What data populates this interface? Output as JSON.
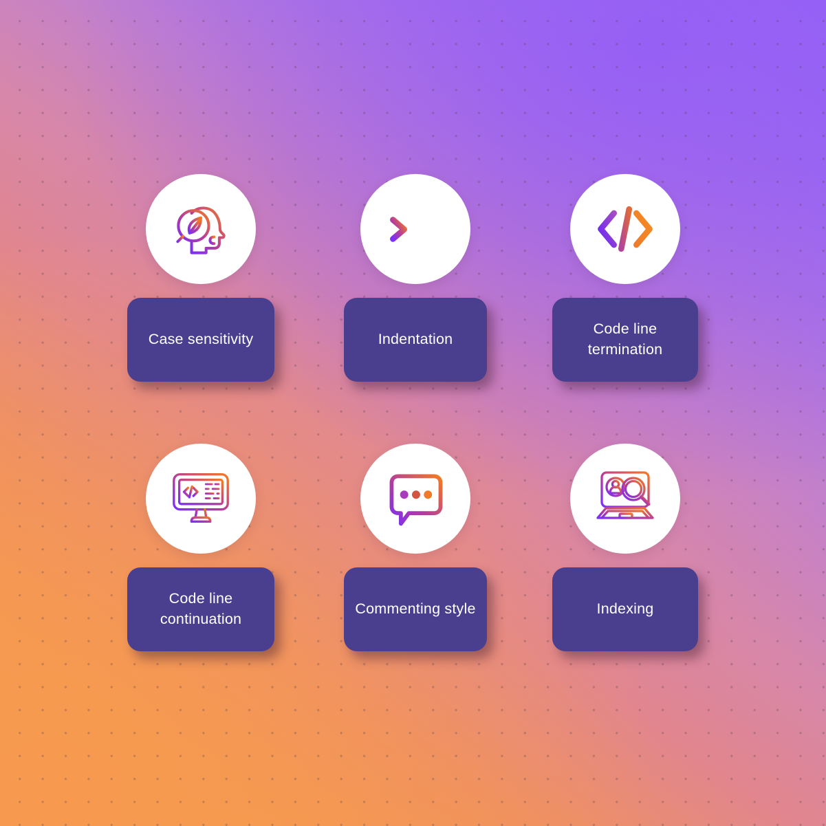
{
  "background": {
    "gradient_from": "#f59a55",
    "gradient_mid": "#de859e",
    "gradient_to": "#9263f4",
    "dot_color": "#5a4150",
    "direction": "bottom-left to top-right"
  },
  "theme": {
    "card_color": "#4a3f8e",
    "card_text_color": "#ffffff",
    "circle_color": "#ffffff",
    "icon_gradient_start": "#8b3ff0",
    "icon_gradient_end": "#f47b20"
  },
  "items": [
    {
      "id": "case-sensitivity",
      "label": "Case sensitivity",
      "icon": "head-leaf-magnifier-icon"
    },
    {
      "id": "indentation",
      "label": "Indentation",
      "icon": "indent-arrow-lines-icon"
    },
    {
      "id": "code-line-termination",
      "label": "Code line\ntermination",
      "icon": "code-brackets-icon"
    },
    {
      "id": "code-line-continuation",
      "label": "Code line\ncontinuation",
      "icon": "monitor-code-icon"
    },
    {
      "id": "commenting-style",
      "label": "Commenting style",
      "icon": "speech-bubble-dots-icon"
    },
    {
      "id": "indexing",
      "label": "Indexing",
      "icon": "laptop-search-profile-icon"
    }
  ]
}
